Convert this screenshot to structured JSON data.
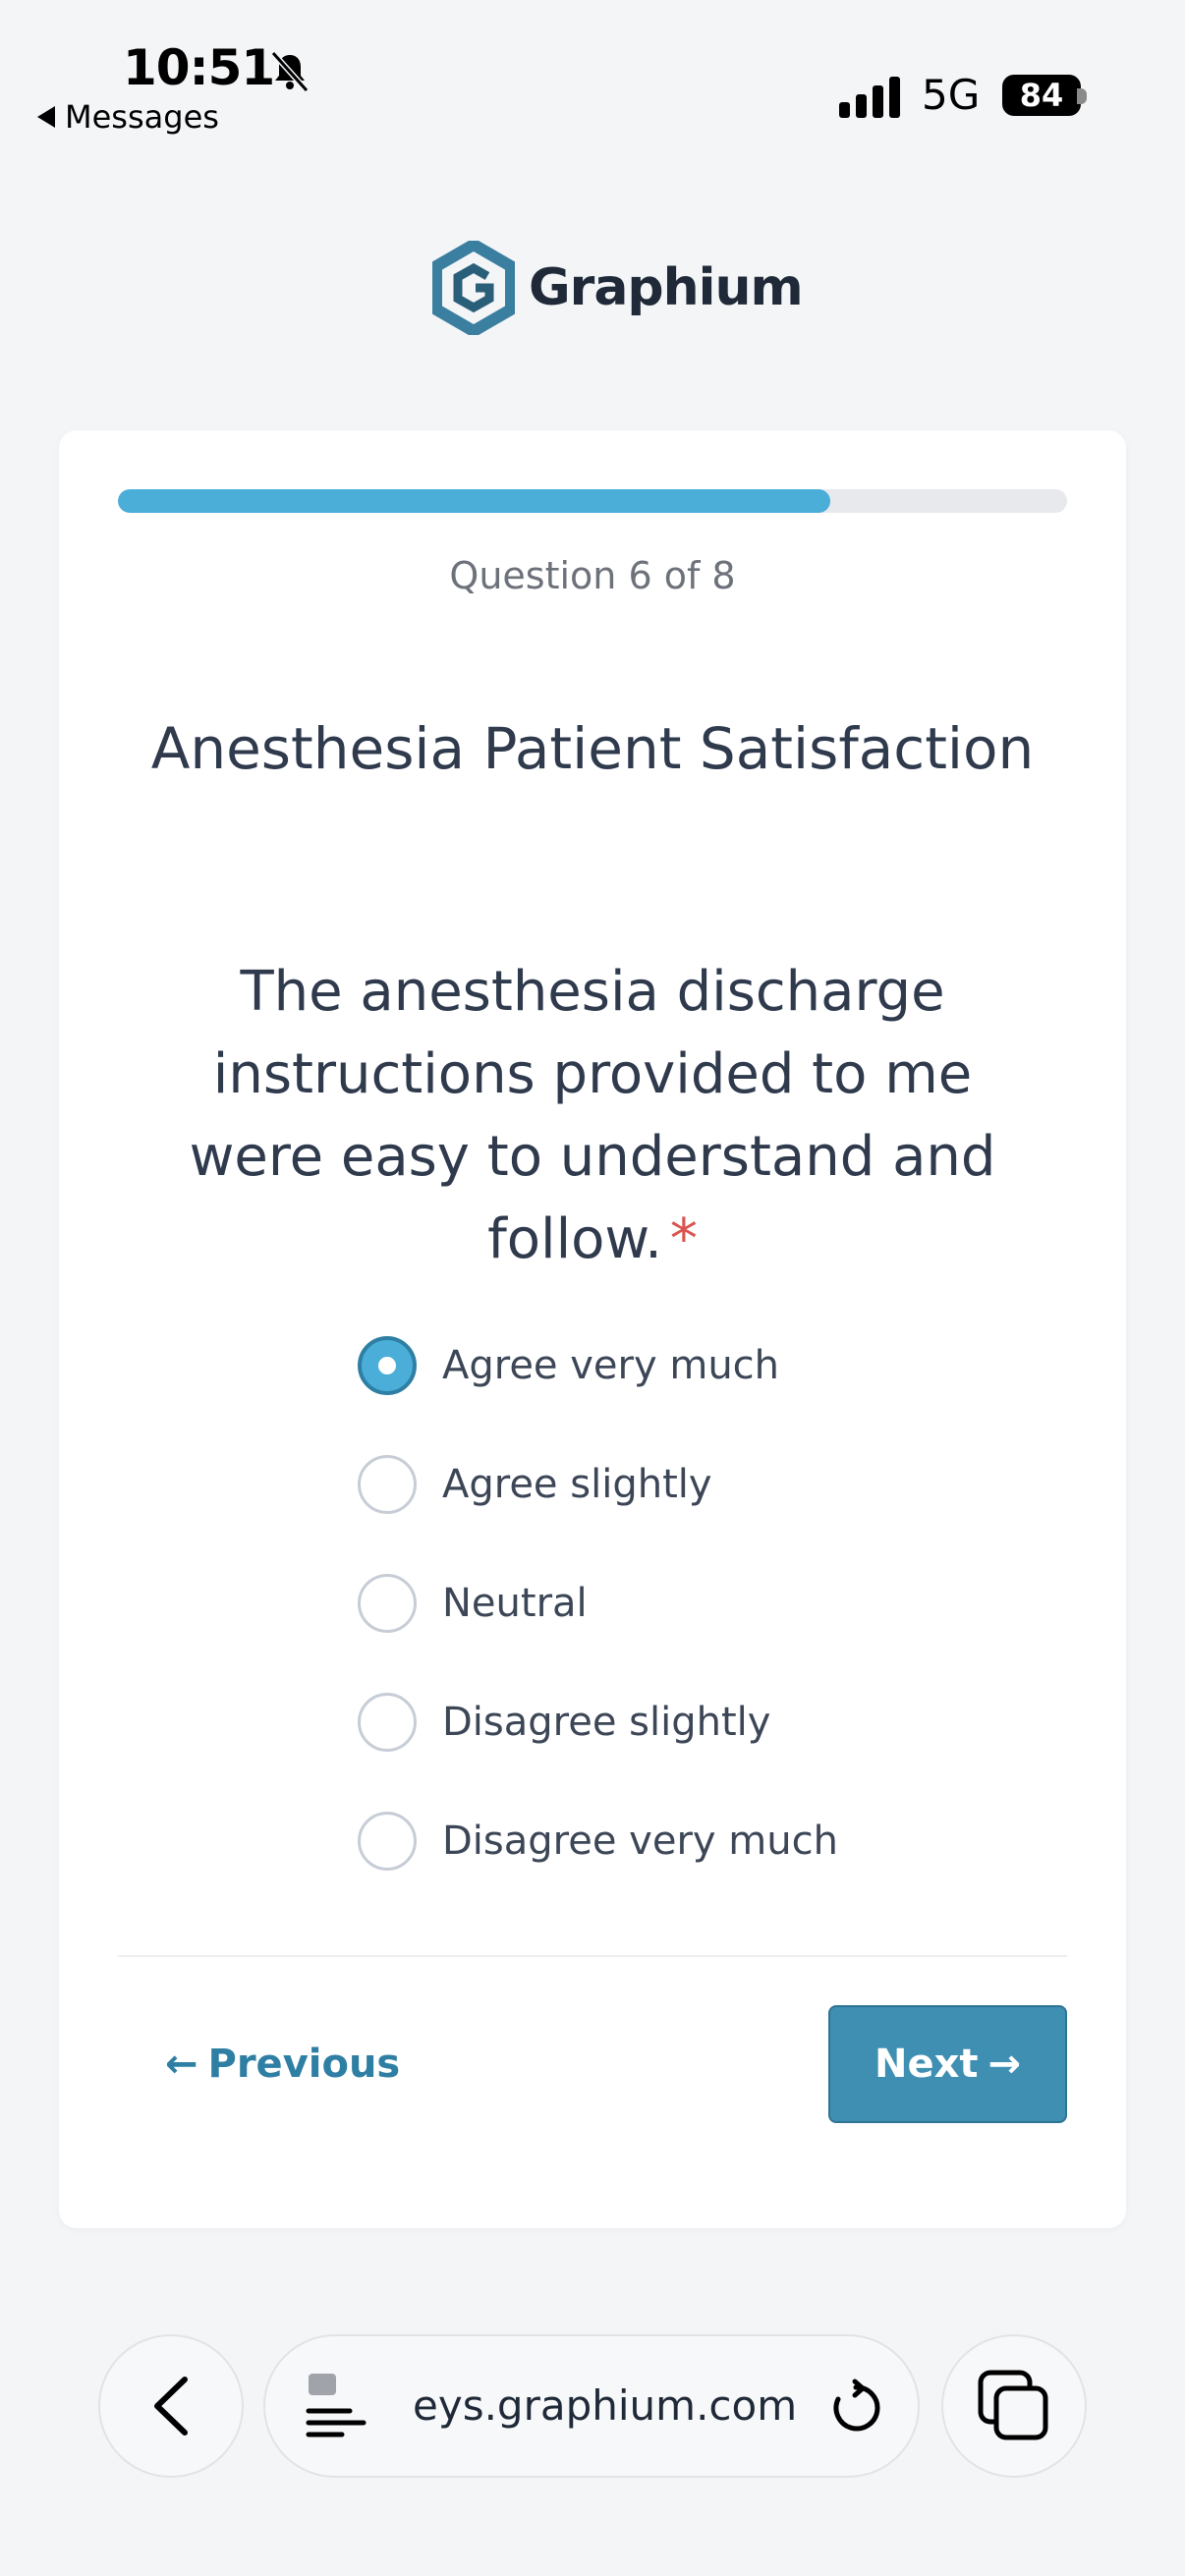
{
  "status_bar": {
    "time": "10:51",
    "back_app": "Messages",
    "network": "5G",
    "battery": "84"
  },
  "logo": {
    "name": "Graphium",
    "color": "#3a7fa0"
  },
  "survey": {
    "progress": {
      "current": 6,
      "total": 8,
      "fraction": 0.75,
      "text": "Question 6 of 8"
    },
    "title": "Anesthesia Patient Satisfaction",
    "question": "The anesthesia discharge instructions provided to me were easy to understand and follow.",
    "required_marker": "*",
    "options": [
      {
        "label": "Agree very much",
        "selected": true
      },
      {
        "label": "Agree slightly",
        "selected": false
      },
      {
        "label": "Neutral",
        "selected": false
      },
      {
        "label": "Disagree slightly",
        "selected": false
      },
      {
        "label": "Disagree very much",
        "selected": false
      }
    ],
    "previous_label": "Previous",
    "next_label": "Next"
  },
  "browser": {
    "url": "eys.graphium.com"
  },
  "colors": {
    "accent": "#4aaed9",
    "button": "#3f8fb3",
    "link": "#2e7fa3",
    "required": "#d9534f"
  }
}
